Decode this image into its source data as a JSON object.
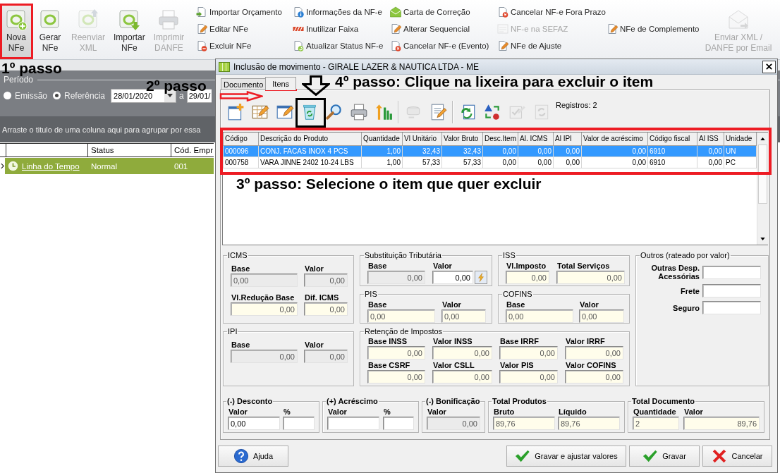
{
  "ribbon": {
    "large_buttons": [
      {
        "label": "Nova\nNFe",
        "hovered": true,
        "disabled": false
      },
      {
        "label": "Gerar\nNFe",
        "hovered": false,
        "disabled": false
      },
      {
        "label": "Reenviar\nXML",
        "hovered": false,
        "disabled": true
      },
      {
        "label": "Importar\nNFe",
        "hovered": false,
        "disabled": false
      },
      {
        "label": "Imprimir\nDANFE",
        "hovered": false,
        "disabled": true
      }
    ],
    "small_button_columns": [
      [
        {
          "label": "Importar Orçamento",
          "disabled": false
        },
        {
          "label": "Editar NFe",
          "disabled": false
        },
        {
          "label": "Excluir NFe",
          "disabled": false
        }
      ],
      [
        {
          "label": "Informações da NF-e",
          "disabled": false
        },
        {
          "label": "Inutilizar Faixa",
          "disabled": false
        },
        {
          "label": "Atualizar Status NF-e",
          "disabled": false
        }
      ],
      [
        {
          "label": "Carta de Correção",
          "disabled": false
        },
        {
          "label": "Alterar Sequencial",
          "disabled": false
        },
        {
          "label": "Cancelar NF-e (Evento)",
          "disabled": false
        }
      ],
      [
        {
          "label": "Cancelar NF-e Fora Prazo",
          "disabled": false
        },
        {
          "label": "NF-e na SEFAZ",
          "disabled": true
        },
        {
          "label": "NFe de Ajuste",
          "disabled": false
        }
      ],
      [
        {
          "label": "NFe de Complemento",
          "disabled": false
        }
      ]
    ],
    "email_button": {
      "label": "Enviar XML /\nDANFE por Email",
      "hovered": false,
      "disabled": true
    }
  },
  "step_captions": [
    "1º passo",
    "2º passo",
    "3º passo: Selecione o item que quer excluir",
    "4º passo: Clique na lixeira para excluir o item"
  ],
  "period_filter": {
    "label": "Período",
    "options": [
      {
        "label": "Emissão",
        "selected": false
      },
      {
        "label": "Referência",
        "selected": true
      }
    ],
    "date_from": "28/01/2020",
    "separator": "a",
    "date_to": "29/01/"
  },
  "group_hint": "Arraste o titulo de uma coluna aqui para agrupar por essa",
  "grid": {
    "columns": [
      "",
      "Status",
      "Cód. Empr"
    ],
    "rows": [
      {
        "selected": true,
        "cells": [
          "Linha do Tempo",
          "Normal",
          "001"
        ]
      }
    ]
  },
  "dialog": {
    "title": "Inclusão de movimento - GIRALE LAZER & NAUTICA LTDA - ME",
    "tabs": [
      {
        "label": "Documento",
        "selected": false
      },
      {
        "label": "Itens",
        "selected": true
      }
    ],
    "toolbar": {
      "groups": [
        [
          {
            "disabled": false
          },
          {
            "disabled": false
          },
          {
            "disabled": false
          },
          {
            "disabled": false
          },
          {
            "disabled": false
          },
          {
            "disabled": false
          },
          {
            "disabled": false
          }
        ],
        [
          {
            "disabled": true
          },
          {
            "disabled": false
          }
        ],
        [
          {
            "disabled": false
          },
          {
            "disabled": false
          },
          {
            "disabled": true
          },
          {
            "disabled": true
          }
        ]
      ],
      "records": "Registros: 2"
    },
    "table": {
      "columns": [
        "Código",
        "Descrição do Produto",
        "Quantidade",
        "Vl Unitário",
        "Valor Bruto",
        "Desc.Item",
        "Al. ICMS",
        "Al IPI",
        "Valor de acréscimo",
        "Código fiscal",
        "Al ISS",
        "Unidade"
      ],
      "rows": [
        {
          "selected": true,
          "cells": [
            "000096",
            "CONJ. FACAS INOX 4 PCS",
            "1,00",
            "32,43",
            "32,43",
            "0,00",
            "0,00",
            "0,00",
            "0,00",
            "6910",
            "0,00",
            "UN"
          ]
        },
        {
          "selected": false,
          "cells": [
            "000758",
            "VARA JINNE 2402 10-24 LBS",
            "1,00",
            "57,33",
            "57,33",
            "0,00",
            "0,00",
            "0,00",
            "0,00",
            "6910",
            "0,00",
            "PC"
          ]
        }
      ]
    },
    "tax_groups": [
      {
        "title": "ICMS",
        "fields": [
          {
            "label": "Base",
            "value": "0,00",
            "kind": "locked"
          },
          {
            "label": "Valor",
            "value": "0,00",
            "kind": "locked"
          },
          {
            "label": "Vl.Redução Base",
            "value": "0,00",
            "kind": "calculated"
          },
          {
            "label": "Dif. ICMS",
            "value": "0,00",
            "kind": "calculated"
          }
        ]
      },
      {
        "title": "Substituição Tributária",
        "fields": [
          {
            "label": "Base",
            "value": "0,00",
            "kind": "locked"
          },
          {
            "label": "Valor",
            "value": "0,00",
            "kind": "lookup"
          }
        ]
      },
      {
        "title": "ISS",
        "fields": [
          {
            "label": "Vl.Imposto",
            "value": "0,00",
            "kind": "calculated"
          },
          {
            "label": "Total Serviços",
            "value": "0,00",
            "kind": "calculated"
          }
        ]
      },
      {
        "title": "Outros (rateado por valor)",
        "fields": [
          {
            "label": "Outras Desp. Acessórias",
            "kind": "input"
          },
          {
            "label": "Frete",
            "kind": "input"
          },
          {
            "label": "Seguro",
            "kind": "input"
          }
        ]
      },
      {
        "title": "PIS",
        "fields": [
          {
            "label": "Base",
            "value": "0,00",
            "kind": "text"
          },
          {
            "label": "Valor",
            "value": "0,00",
            "kind": "text"
          }
        ]
      },
      {
        "title": "COFINS",
        "fields": [
          {
            "label": "Base",
            "value": "0,00",
            "kind": "text"
          },
          {
            "label": "Valor",
            "value": "0,00",
            "kind": "text"
          }
        ]
      },
      {
        "title": "IPI",
        "fields": [
          {
            "label": "Base",
            "value": "0,00",
            "kind": "locked"
          },
          {
            "label": "Valor",
            "value": "0,00",
            "kind": "locked"
          }
        ]
      },
      {
        "title": "Retenção de Impostos",
        "fields": [
          {
            "label": "Base INSS",
            "value": "0,00",
            "kind": "calculated"
          },
          {
            "label": "Valor INSS",
            "value": "0,00",
            "kind": "calculated"
          },
          {
            "label": "Base IRRF",
            "value": "0,00",
            "kind": "calculated"
          },
          {
            "label": "Valor IRRF",
            "value": "0,00",
            "kind": "calculated"
          },
          {
            "label": "Base CSRF",
            "value": "0,00",
            "kind": "calculated"
          },
          {
            "label": "Valor CSLL",
            "value": "0,00",
            "kind": "calculated"
          },
          {
            "label": "Valor PIS",
            "value": "0,00",
            "kind": "calculated"
          },
          {
            "label": "Valor COFINS",
            "value": "0,00",
            "kind": "calculated"
          }
        ]
      }
    ],
    "total_groups": [
      {
        "title": "(-) Desconto",
        "fields": [
          {
            "label": "Valor",
            "value": "0,00",
            "kind": "input"
          },
          {
            "label": "%",
            "kind": "input"
          }
        ]
      },
      {
        "title": "(+) Acréscimo",
        "fields": [
          {
            "label": "Valor",
            "kind": "input"
          },
          {
            "label": "%",
            "kind": "input"
          }
        ]
      },
      {
        "title": "(-) Bonificação",
        "fields": [
          {
            "label": "Valor",
            "value": "0,00",
            "kind": "locked"
          }
        ]
      },
      {
        "title": "Total Produtos",
        "fields": [
          {
            "label": "Bruto",
            "value": "89,76",
            "kind": "text"
          },
          {
            "label": "Líquido",
            "value": "89,76",
            "kind": "text"
          }
        ]
      },
      {
        "title": "Total Documento",
        "fields": [
          {
            "label": "Quantidade",
            "value": "2",
            "kind": "text"
          },
          {
            "label": "Valor",
            "value": "89,76",
            "kind": "calculated"
          }
        ]
      }
    ],
    "buttons": [
      {
        "label": "Ajuda"
      },
      {
        "label": "Gravar e ajustar valores"
      },
      {
        "label": "Gravar"
      },
      {
        "label": "Cancelar"
      }
    ]
  }
}
